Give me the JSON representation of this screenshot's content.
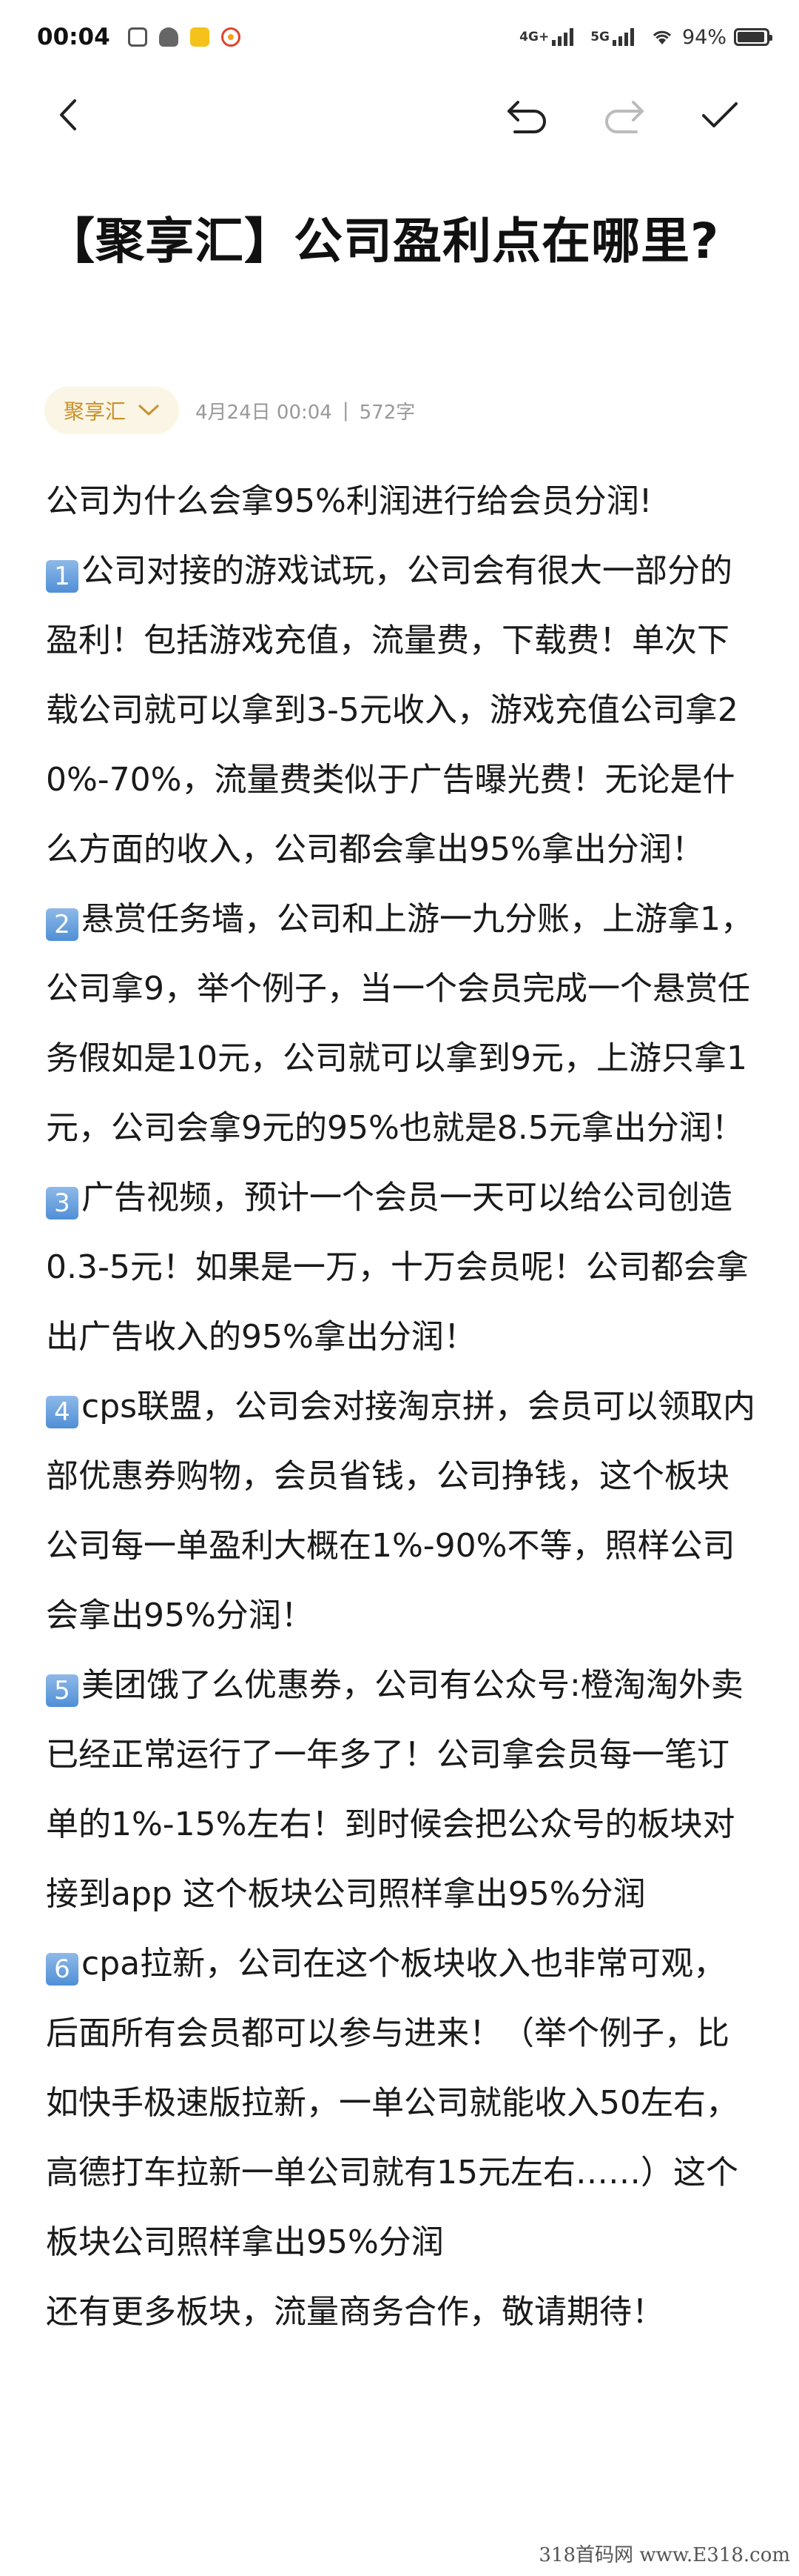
{
  "status_bar": {
    "time": "00:04",
    "network_1": "4G+",
    "network_2": "5G",
    "battery": "94%",
    "battery_level": 0.94
  },
  "toolbar": {
    "back_icon": "chevron-left-icon",
    "undo_icon": "undo-icon",
    "redo_icon": "redo-icon",
    "done_icon": "check-icon"
  },
  "article": {
    "title": "【聚享汇】公司盈利点在哪里?",
    "author": "聚享汇",
    "date": "4月24日 00:04",
    "sep": "|",
    "word_count": "572字",
    "intro": "公司为什么会拿95%利润进行给会员分润!",
    "sections": [
      {
        "num": "1",
        "text": "公司对接的游戏试玩，公司会有很大一部分的盈利！包括游戏充值，流量费，下载费！单次下载公司就可以拿到3-5元收入，游戏充值公司拿20%-70%，流量费类似于广告曝光费！无论是什么方面的收入，公司都会拿出95%拿出分润！"
      },
      {
        "num": "2",
        "text": "悬赏任务墙，公司和上游一九分账，上游拿1，公司拿9，举个例子，当一个会员完成一个悬赏任务假如是10元，公司就可以拿到9元，上游只拿1元，公司会拿9元的95%也就是8.5元拿出分润！"
      },
      {
        "num": "3",
        "text": "广告视频，预计一个会员一天可以给公司创造0.3-5元！如果是一万，十万会员呢！公司都会拿出广告收入的95%拿出分润！"
      },
      {
        "num": "4",
        "text": "cps联盟，公司会对接淘京拼，会员可以领取内部优惠券购物，会员省钱，公司挣钱，这个板块公司每一单盈利大概在1%-90%不等，照样公司会拿出95%分润！"
      },
      {
        "num": "5",
        "text": "美团饿了么优惠券，公司有公众号:橙淘淘外卖   已经正常运行了一年多了！公司拿会员每一笔订单的1%-15%左右！到时候会把公众号的板块对接到app 这个板块公司照样拿出95%分润"
      },
      {
        "num": "6",
        "text": "cpa拉新，公司在这个板块收入也非常可观，后面所有会员都可以参与进来！（举个例子，比如快手极速版拉新，一单公司就能收入50左右，高德打车拉新一单公司就有15元左右……）这个板块公司照样拿出95%分润"
      }
    ],
    "outro": "还有更多板块，流量商务合作，敬请期待！"
  },
  "watermark": "318首码网 www.E318.com"
}
